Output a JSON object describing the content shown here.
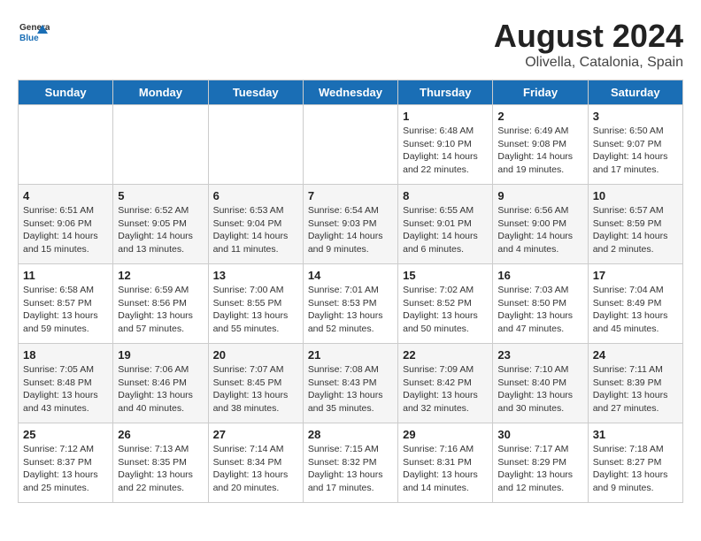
{
  "header": {
    "logo_line1": "General",
    "logo_line2": "Blue",
    "month": "August 2024",
    "location": "Olivella, Catalonia, Spain"
  },
  "days_of_week": [
    "Sunday",
    "Monday",
    "Tuesday",
    "Wednesday",
    "Thursday",
    "Friday",
    "Saturday"
  ],
  "weeks": [
    [
      {
        "num": "",
        "info": ""
      },
      {
        "num": "",
        "info": ""
      },
      {
        "num": "",
        "info": ""
      },
      {
        "num": "",
        "info": ""
      },
      {
        "num": "1",
        "info": "Sunrise: 6:48 AM\nSunset: 9:10 PM\nDaylight: 14 hours\nand 22 minutes."
      },
      {
        "num": "2",
        "info": "Sunrise: 6:49 AM\nSunset: 9:08 PM\nDaylight: 14 hours\nand 19 minutes."
      },
      {
        "num": "3",
        "info": "Sunrise: 6:50 AM\nSunset: 9:07 PM\nDaylight: 14 hours\nand 17 minutes."
      }
    ],
    [
      {
        "num": "4",
        "info": "Sunrise: 6:51 AM\nSunset: 9:06 PM\nDaylight: 14 hours\nand 15 minutes."
      },
      {
        "num": "5",
        "info": "Sunrise: 6:52 AM\nSunset: 9:05 PM\nDaylight: 14 hours\nand 13 minutes."
      },
      {
        "num": "6",
        "info": "Sunrise: 6:53 AM\nSunset: 9:04 PM\nDaylight: 14 hours\nand 11 minutes."
      },
      {
        "num": "7",
        "info": "Sunrise: 6:54 AM\nSunset: 9:03 PM\nDaylight: 14 hours\nand 9 minutes."
      },
      {
        "num": "8",
        "info": "Sunrise: 6:55 AM\nSunset: 9:01 PM\nDaylight: 14 hours\nand 6 minutes."
      },
      {
        "num": "9",
        "info": "Sunrise: 6:56 AM\nSunset: 9:00 PM\nDaylight: 14 hours\nand 4 minutes."
      },
      {
        "num": "10",
        "info": "Sunrise: 6:57 AM\nSunset: 8:59 PM\nDaylight: 14 hours\nand 2 minutes."
      }
    ],
    [
      {
        "num": "11",
        "info": "Sunrise: 6:58 AM\nSunset: 8:57 PM\nDaylight: 13 hours\nand 59 minutes."
      },
      {
        "num": "12",
        "info": "Sunrise: 6:59 AM\nSunset: 8:56 PM\nDaylight: 13 hours\nand 57 minutes."
      },
      {
        "num": "13",
        "info": "Sunrise: 7:00 AM\nSunset: 8:55 PM\nDaylight: 13 hours\nand 55 minutes."
      },
      {
        "num": "14",
        "info": "Sunrise: 7:01 AM\nSunset: 8:53 PM\nDaylight: 13 hours\nand 52 minutes."
      },
      {
        "num": "15",
        "info": "Sunrise: 7:02 AM\nSunset: 8:52 PM\nDaylight: 13 hours\nand 50 minutes."
      },
      {
        "num": "16",
        "info": "Sunrise: 7:03 AM\nSunset: 8:50 PM\nDaylight: 13 hours\nand 47 minutes."
      },
      {
        "num": "17",
        "info": "Sunrise: 7:04 AM\nSunset: 8:49 PM\nDaylight: 13 hours\nand 45 minutes."
      }
    ],
    [
      {
        "num": "18",
        "info": "Sunrise: 7:05 AM\nSunset: 8:48 PM\nDaylight: 13 hours\nand 43 minutes."
      },
      {
        "num": "19",
        "info": "Sunrise: 7:06 AM\nSunset: 8:46 PM\nDaylight: 13 hours\nand 40 minutes."
      },
      {
        "num": "20",
        "info": "Sunrise: 7:07 AM\nSunset: 8:45 PM\nDaylight: 13 hours\nand 38 minutes."
      },
      {
        "num": "21",
        "info": "Sunrise: 7:08 AM\nSunset: 8:43 PM\nDaylight: 13 hours\nand 35 minutes."
      },
      {
        "num": "22",
        "info": "Sunrise: 7:09 AM\nSunset: 8:42 PM\nDaylight: 13 hours\nand 32 minutes."
      },
      {
        "num": "23",
        "info": "Sunrise: 7:10 AM\nSunset: 8:40 PM\nDaylight: 13 hours\nand 30 minutes."
      },
      {
        "num": "24",
        "info": "Sunrise: 7:11 AM\nSunset: 8:39 PM\nDaylight: 13 hours\nand 27 minutes."
      }
    ],
    [
      {
        "num": "25",
        "info": "Sunrise: 7:12 AM\nSunset: 8:37 PM\nDaylight: 13 hours\nand 25 minutes."
      },
      {
        "num": "26",
        "info": "Sunrise: 7:13 AM\nSunset: 8:35 PM\nDaylight: 13 hours\nand 22 minutes."
      },
      {
        "num": "27",
        "info": "Sunrise: 7:14 AM\nSunset: 8:34 PM\nDaylight: 13 hours\nand 20 minutes."
      },
      {
        "num": "28",
        "info": "Sunrise: 7:15 AM\nSunset: 8:32 PM\nDaylight: 13 hours\nand 17 minutes."
      },
      {
        "num": "29",
        "info": "Sunrise: 7:16 AM\nSunset: 8:31 PM\nDaylight: 13 hours\nand 14 minutes."
      },
      {
        "num": "30",
        "info": "Sunrise: 7:17 AM\nSunset: 8:29 PM\nDaylight: 13 hours\nand 12 minutes."
      },
      {
        "num": "31",
        "info": "Sunrise: 7:18 AM\nSunset: 8:27 PM\nDaylight: 13 hours\nand 9 minutes."
      }
    ]
  ]
}
